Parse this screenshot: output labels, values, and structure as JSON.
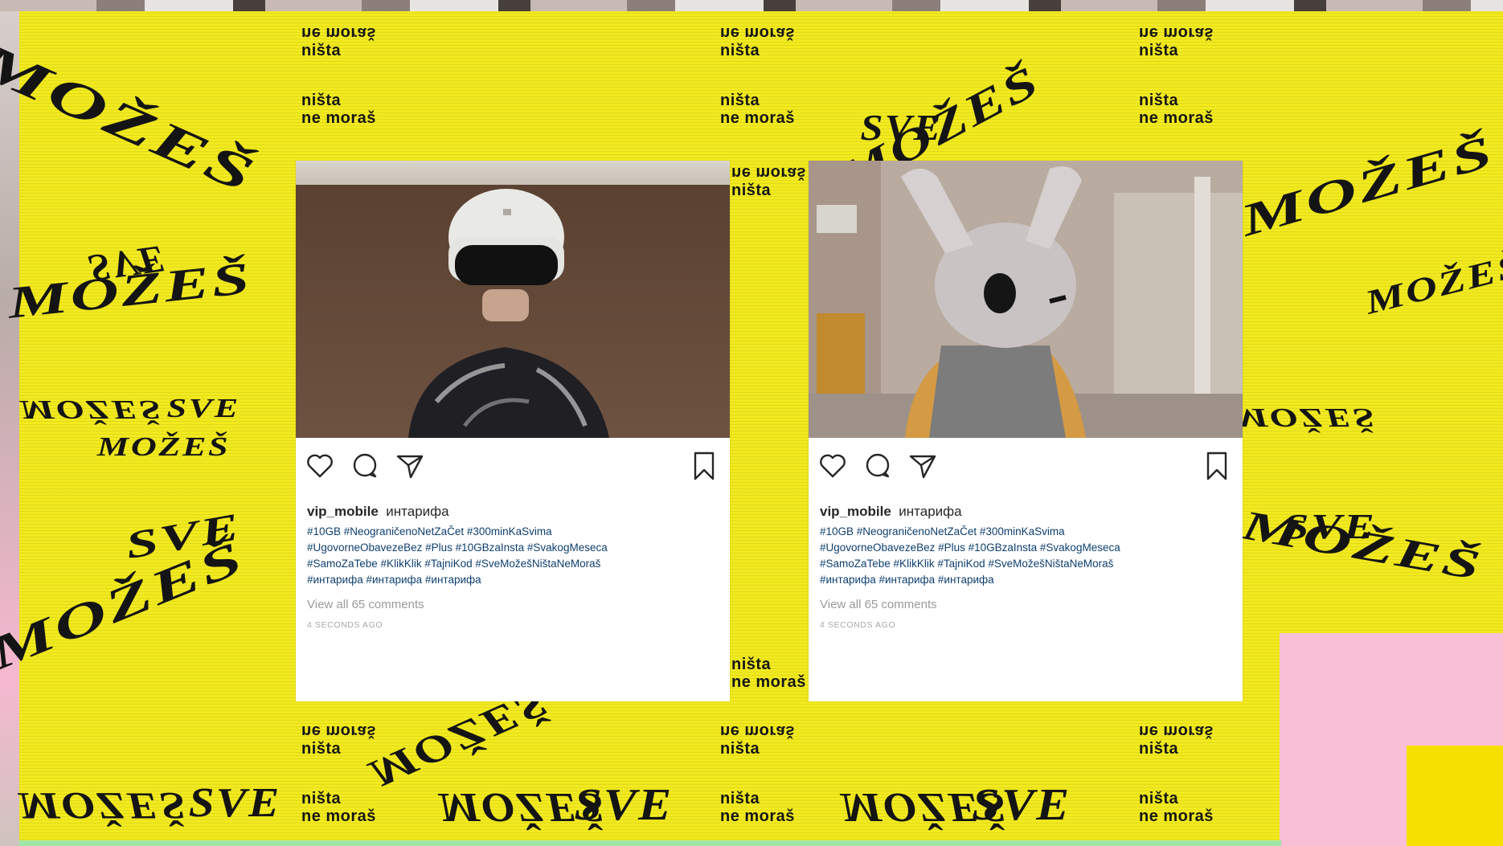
{
  "background": {
    "accent_yellow": "#f2ea1e",
    "accent_pink": "#f8bfd6",
    "tag_lines": [
      "ne moraš",
      "ništa",
      "ništa",
      "ne moraš"
    ],
    "words": {
      "sve": "SVE",
      "mozes": "MOŽEŠ",
      "mozes_upper": "MOŽEŠ"
    }
  },
  "posts": [
    {
      "username": "vip_mobile",
      "caption_tail": "интарифа",
      "hashtag_lines": [
        "#10GB #NeograničenoNetZaČet #300minKaSvima",
        "#UgovorneObavezeBez #Plus #10GBzaInsta #SvakogMeseca",
        "#SamoZaTebe #KlikKlik #TajniKod #SveMožešNištaNeMoraš",
        "#интарифа #интарифа #интарифа"
      ],
      "comments": "View all 65 comments",
      "time": "4 SECONDS AGO",
      "photo": "person-in-helmet",
      "icons": [
        "heart-icon",
        "comment-icon",
        "share-icon",
        "bookmark-icon"
      ]
    },
    {
      "username": "vip_mobile",
      "caption_tail": "интарифа",
      "hashtag_lines": [
        "#10GB #NeograničenoNetZaČet #300minKaSvima",
        "#UgovorneObavezeBez #Plus #10GBzaInsta #SvakogMeseca",
        "#SamoZaTebe #KlikKlik #TajniKod #SveMožešNištaNeMoraš",
        "#интарифа #интарифа #интарифа"
      ],
      "comments": "View all 65 comments",
      "time": "4 SECONDS AGO",
      "photo": "person-in-rabbit-mask",
      "icons": [
        "heart-icon",
        "comment-icon",
        "share-icon",
        "bookmark-icon"
      ]
    }
  ]
}
